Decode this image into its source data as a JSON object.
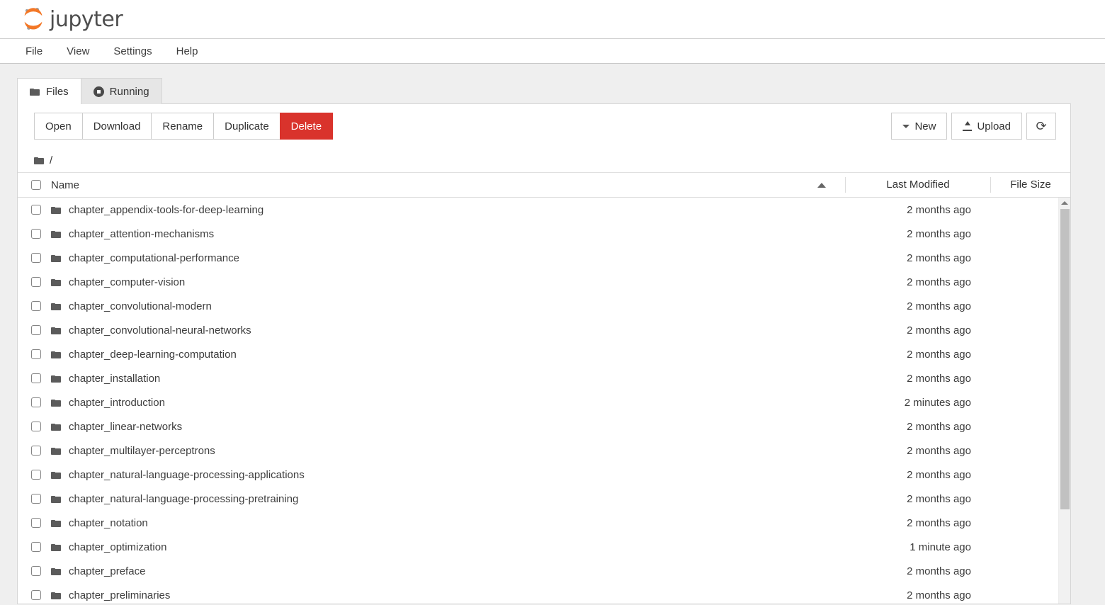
{
  "brand": {
    "name": "jupyter",
    "logo_icon": "jupyter-logo-icon",
    "accent_color": "#f37726"
  },
  "menubar": {
    "items": [
      {
        "label": "File"
      },
      {
        "label": "View"
      },
      {
        "label": "Settings"
      },
      {
        "label": "Help"
      }
    ]
  },
  "tabs": [
    {
      "label": "Files",
      "icon": "folder-icon",
      "active": true
    },
    {
      "label": "Running",
      "icon": "running-circle-icon",
      "active": false
    }
  ],
  "toolbar": {
    "left_buttons": [
      {
        "label": "Open",
        "style": "default"
      },
      {
        "label": "Download",
        "style": "default"
      },
      {
        "label": "Rename",
        "style": "default"
      },
      {
        "label": "Duplicate",
        "style": "default"
      },
      {
        "label": "Delete",
        "style": "danger"
      }
    ],
    "new_label": "New",
    "upload_label": "Upload",
    "refresh_icon": "refresh-icon",
    "refresh_glyph": "⟳",
    "danger_color": "#d9332c"
  },
  "breadcrumb": {
    "icon": "folder-icon",
    "path": "/"
  },
  "table": {
    "columns": {
      "name": "Name",
      "last_modified": "Last Modified",
      "file_size": "File Size"
    },
    "sort": {
      "column": "Name",
      "direction": "ascending",
      "icon": "sort-ascending-icon"
    },
    "rows": [
      {
        "name": "chapter_appendix-tools-for-deep-learning",
        "modified": "2 months ago",
        "size": "",
        "icon": "folder-icon"
      },
      {
        "name": "chapter_attention-mechanisms",
        "modified": "2 months ago",
        "size": "",
        "icon": "folder-icon"
      },
      {
        "name": "chapter_computational-performance",
        "modified": "2 months ago",
        "size": "",
        "icon": "folder-icon"
      },
      {
        "name": "chapter_computer-vision",
        "modified": "2 months ago",
        "size": "",
        "icon": "folder-icon"
      },
      {
        "name": "chapter_convolutional-modern",
        "modified": "2 months ago",
        "size": "",
        "icon": "folder-icon"
      },
      {
        "name": "chapter_convolutional-neural-networks",
        "modified": "2 months ago",
        "size": "",
        "icon": "folder-icon"
      },
      {
        "name": "chapter_deep-learning-computation",
        "modified": "2 months ago",
        "size": "",
        "icon": "folder-icon"
      },
      {
        "name": "chapter_installation",
        "modified": "2 months ago",
        "size": "",
        "icon": "folder-icon"
      },
      {
        "name": "chapter_introduction",
        "modified": "2 minutes ago",
        "size": "",
        "icon": "folder-icon"
      },
      {
        "name": "chapter_linear-networks",
        "modified": "2 months ago",
        "size": "",
        "icon": "folder-icon"
      },
      {
        "name": "chapter_multilayer-perceptrons",
        "modified": "2 months ago",
        "size": "",
        "icon": "folder-icon"
      },
      {
        "name": "chapter_natural-language-processing-applications",
        "modified": "2 months ago",
        "size": "",
        "icon": "folder-icon"
      },
      {
        "name": "chapter_natural-language-processing-pretraining",
        "modified": "2 months ago",
        "size": "",
        "icon": "folder-icon"
      },
      {
        "name": "chapter_notation",
        "modified": "2 months ago",
        "size": "",
        "icon": "folder-icon"
      },
      {
        "name": "chapter_optimization",
        "modified": "1 minute ago",
        "size": "",
        "icon": "folder-icon"
      },
      {
        "name": "chapter_preface",
        "modified": "2 months ago",
        "size": "",
        "icon": "folder-icon"
      },
      {
        "name": "chapter_preliminaries",
        "modified": "2 months ago",
        "size": "",
        "icon": "folder-icon"
      }
    ]
  },
  "scrollbar": {
    "up_arrow_icon": "scroll-up-arrow-icon",
    "thumb": "vertical-scroll-thumb"
  }
}
